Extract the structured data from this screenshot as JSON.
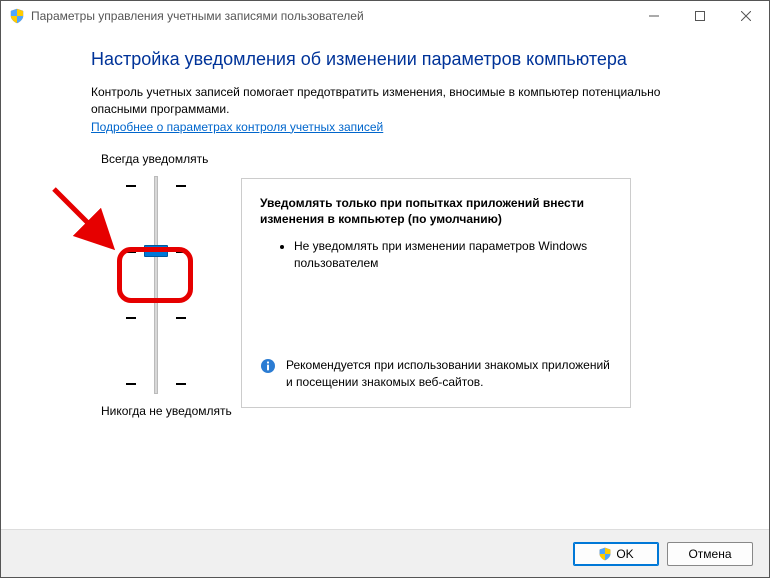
{
  "window": {
    "title": "Параметры управления учетными записями пользователей"
  },
  "page": {
    "heading": "Настройка уведомления об изменении параметров компьютера",
    "description": "Контроль учетных записей помогает предотвратить изменения, вносимые в компьютер потенциально опасными программами.",
    "link": "Подробнее о параметрах контроля учетных записей"
  },
  "slider": {
    "top_label": "Всегда уведомлять",
    "bottom_label": "Никогда не уведомлять",
    "levels": 4,
    "selected_index": 1
  },
  "info": {
    "title": "Уведомлять только при попытках приложений внести изменения в компьютер (по умолчанию)",
    "bullet1": "Не уведомлять при изменении параметров Windows пользователем",
    "recommendation": "Рекомендуется при использовании знакомых приложений и посещении знакомых веб-сайтов."
  },
  "buttons": {
    "ok": "OK",
    "cancel": "Отмена"
  }
}
